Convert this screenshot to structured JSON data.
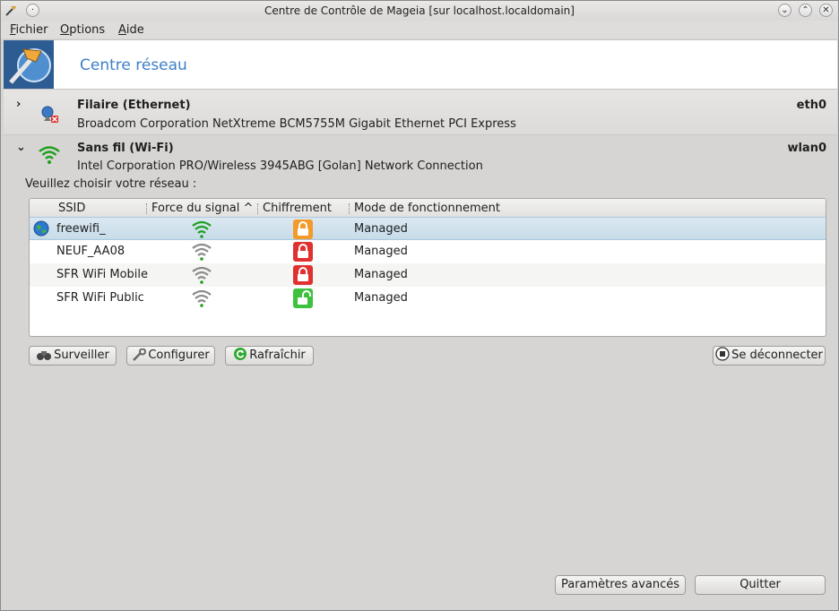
{
  "window": {
    "title": "Centre de Contrôle de Mageia  [sur localhost.localdomain]",
    "controls": {
      "shade": "⌄",
      "maximize": "⌃",
      "close": "✕"
    }
  },
  "menubar": {
    "items": [
      {
        "first": "F",
        "rest": "ichier"
      },
      {
        "first": "O",
        "rest": "ptions"
      },
      {
        "first": "A",
        "rest": "ide"
      }
    ]
  },
  "banner": {
    "title": "Centre réseau"
  },
  "ethernet": {
    "name": "Filaire (Ethernet)",
    "description": "Broadcom Corporation NetXtreme BCM5755M Gigabit Ethernet PCI Express",
    "interface": "eth0",
    "expander": "›",
    "icon": "ethernet-disconnected-icon"
  },
  "wifi": {
    "name": "Sans fil (Wi-Fi)",
    "description": "Intel Corporation PRO/Wireless 3945ABG [Golan] Network Connection",
    "interface": "wlan0",
    "expander": "⌄",
    "icon": "wifi-signal-icon",
    "choose_label": "Veuillez choisir votre réseau :"
  },
  "networks_table": {
    "columns": {
      "ssid": "SSID",
      "signal": "Force du signal",
      "sort_indicator": "^",
      "encryption": "Chiffrement",
      "mode": "Mode de fonctionnement"
    },
    "rows": [
      {
        "ssid": "freewifi_",
        "signal": "strong",
        "encryption": "wep-orange-lock",
        "mode": "Managed",
        "selected": true,
        "connected": true
      },
      {
        "ssid": "NEUF_AA08",
        "signal": "weak",
        "encryption": "wpa-red-lock",
        "mode": "Managed",
        "selected": false,
        "connected": false
      },
      {
        "ssid": "SFR WiFi Mobile",
        "signal": "weak",
        "encryption": "wpa-red-lock",
        "mode": "Managed",
        "selected": false,
        "connected": false
      },
      {
        "ssid": "SFR WiFi Public",
        "signal": "weak",
        "encryption": "open-green-lock",
        "mode": "Managed",
        "selected": false,
        "connected": false
      }
    ]
  },
  "actions": {
    "monitor": "Surveiller",
    "configure": "Configurer",
    "refresh": "Rafraîchir",
    "disconnect": "Se déconnecter"
  },
  "footer": {
    "advanced": "Paramètres avancés",
    "quit": "Quitter"
  },
  "colors": {
    "accent_title": "#3f7fc7",
    "signal_strong": "#1ea01e",
    "signal_weak": "#8a8a8a",
    "lock_orange": "#f39a2a",
    "lock_red": "#e03030",
    "lock_green": "#3cc23c",
    "selection": "#c7dce9"
  }
}
